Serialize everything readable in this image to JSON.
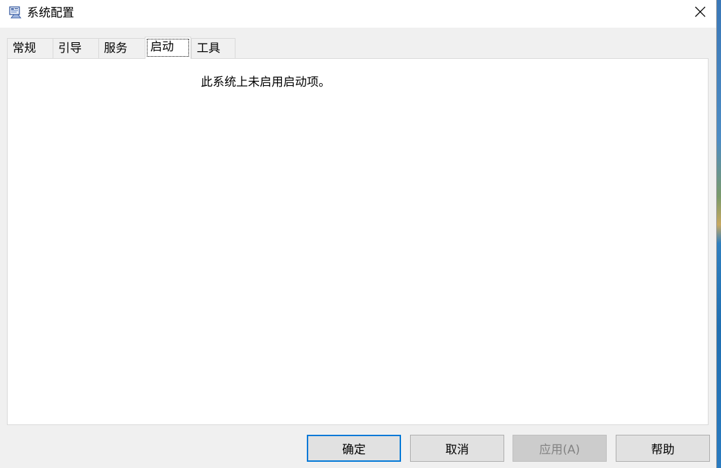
{
  "window": {
    "title": "系统配置",
    "icon": "msconfig-app-icon",
    "close_icon": "close-icon"
  },
  "tabs": [
    {
      "label": "常规",
      "active": false
    },
    {
      "label": "引导",
      "active": false
    },
    {
      "label": "服务",
      "active": false
    },
    {
      "label": "启动",
      "active": true
    },
    {
      "label": "工具",
      "active": false
    }
  ],
  "panel": {
    "message": "此系统上未启用启动项。"
  },
  "buttons": {
    "ok": "确定",
    "cancel": "取消",
    "apply": "应用(A)",
    "help": "帮助"
  },
  "colors": {
    "accent": "#0078d7",
    "window_bg": "#f0f0f0",
    "panel_bg": "#ffffff",
    "disabled_text": "#838383"
  }
}
